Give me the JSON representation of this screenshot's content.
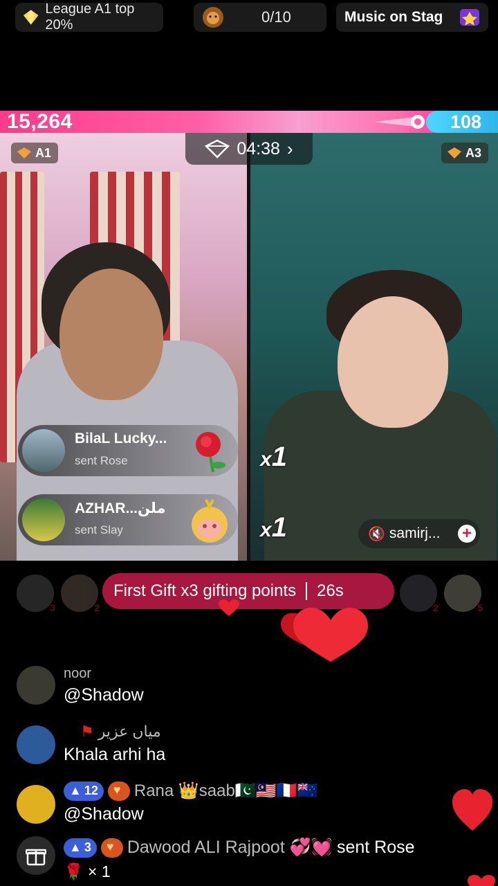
{
  "top": {
    "league_label": "League A1 top 20%",
    "counter": "0/10",
    "music_label": "Music on Stag",
    "icons": [
      "diamond-icon",
      "lion-icon",
      "music-stage-icon"
    ]
  },
  "battle": {
    "score_left": "15,264",
    "score_right": "108",
    "timer": "04:38",
    "left_rank": "A1",
    "right_rank": "A3",
    "colors": {
      "left": "#ff3b8d",
      "right": "#2fb5ea"
    }
  },
  "gifts": [
    {
      "name": "BilaL Lucky...",
      "action": "sent Rose",
      "gift_icon": "rose-icon"
    },
    {
      "name": "AZHAR...ملن",
      "action": "sent Slay",
      "gift_icon": "slay-sticker-icon"
    }
  ],
  "combo": {
    "first": "x",
    "first_count": "1",
    "second": "x",
    "second_count": "1"
  },
  "guest": {
    "name": "samirj...",
    "plus": "+"
  },
  "banner": {
    "text": "First Gift x3 gifting points",
    "countdown": "26s"
  },
  "viewers": [
    {
      "rank": "3"
    },
    {
      "rank": "2"
    },
    {
      "rank": "2"
    },
    {
      "rank": "5"
    }
  ],
  "chat": [
    {
      "user": "noor",
      "message": "@Shadow"
    },
    {
      "user": "میاں عزیر",
      "message": "Khala arhi ha"
    },
    {
      "level": "12",
      "user": "Rana 👑saab🇵🇰🇲🇾🇫🇷🇳🇿",
      "message": "@Shadow"
    },
    {
      "level": "3",
      "user": "Dawood ALI Rajpoot 💞💓",
      "action": "sent Rose",
      "message": "× 1"
    }
  ]
}
